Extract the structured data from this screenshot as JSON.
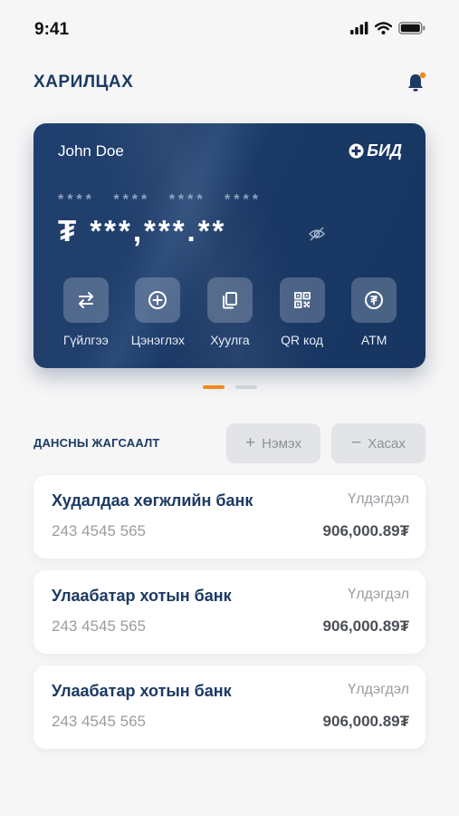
{
  "status_bar": {
    "time": "9:41"
  },
  "header": {
    "title": "ХАРИЛЦАХ"
  },
  "card": {
    "holder": "John Doe",
    "logo_text": "БИД",
    "masked_number": "**** **** **** ****",
    "masked_balance": "₮ ***,***.**",
    "actions": [
      {
        "label": "Гүйлгээ",
        "icon": "transfer-icon"
      },
      {
        "label": "Цэнэглэх",
        "icon": "plus-circle-icon"
      },
      {
        "label": "Хуулга",
        "icon": "copy-icon"
      },
      {
        "label": "QR код",
        "icon": "qr-code-icon"
      },
      {
        "label": "ATM",
        "icon": "atm-icon"
      }
    ]
  },
  "pager": {
    "total": 2,
    "active": 1
  },
  "accounts_section": {
    "title": "ДАНСНЫ ЖАГСААЛТ",
    "add_label": "Нэмэх",
    "remove_label": "Хасах"
  },
  "accounts": [
    {
      "name": "Худалдаа хөгжлийн банк",
      "number": "243 4545 565",
      "balance_label": "Үлдэгдэл",
      "balance": "906,000.89₮"
    },
    {
      "name": "Улаабатар хотын банк",
      "number": "243 4545 565",
      "balance_label": "Үлдэгдэл",
      "balance": "906,000.89₮"
    },
    {
      "name": "Улаабатар хотын банк",
      "number": "243 4545 565",
      "balance_label": "Үлдэгдэл",
      "balance": "906,000.89₮"
    }
  ],
  "colors": {
    "card": "#1b3966",
    "accent": "#f28a1b",
    "title": "#1c3a63",
    "background": "#f6f6f7"
  }
}
